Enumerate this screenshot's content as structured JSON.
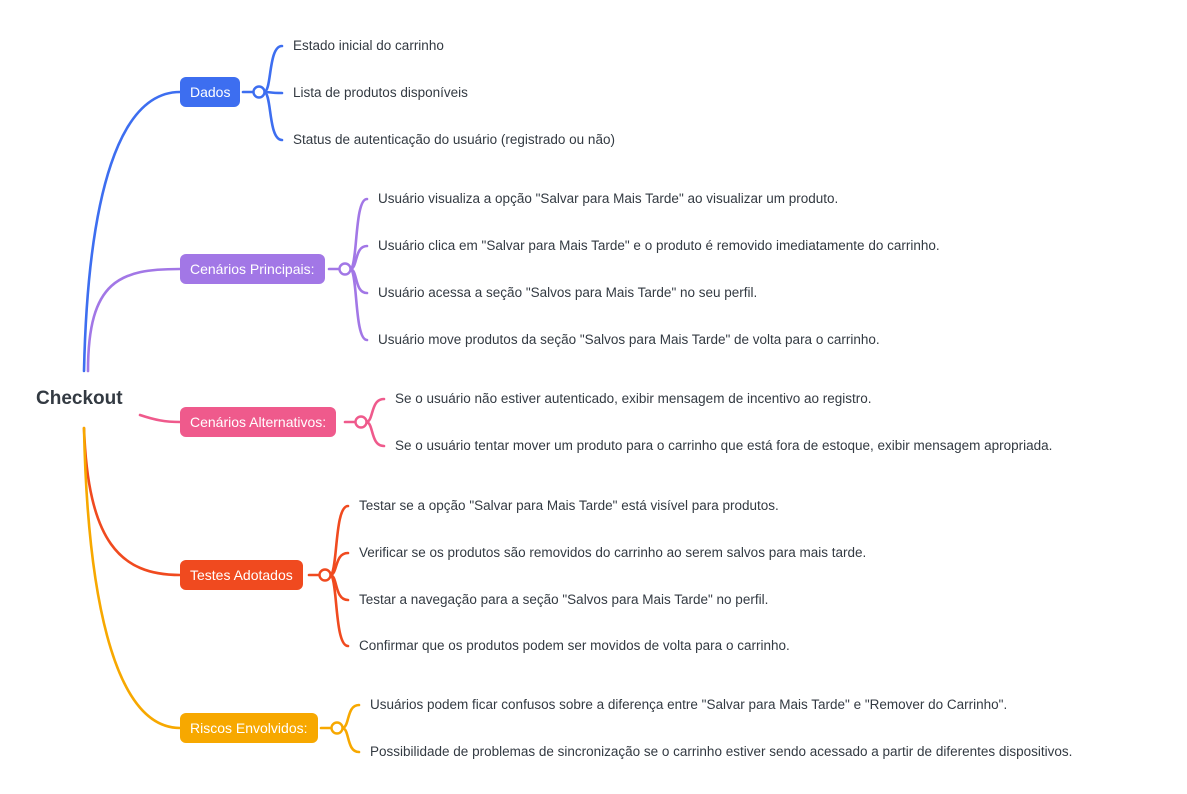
{
  "root": {
    "label": "Checkout"
  },
  "colors": {
    "dados": "#3d6ef0",
    "cenarios_principais": "#a277e6",
    "cenarios_alternativos": "#ef5a8c",
    "testes_adotados": "#f04a1f",
    "riscos_envolvidos": "#f7a800",
    "text": "#333a42"
  },
  "branches": [
    {
      "label": "Dados",
      "items": [
        "Estado inicial do carrinho",
        "Lista de produtos disponíveis",
        "Status de autenticação do usuário (registrado ou não)"
      ]
    },
    {
      "label": "Cenários Principais:",
      "items": [
        "Usuário visualiza a opção \"Salvar para Mais Tarde\" ao visualizar um produto.",
        "Usuário clica em \"Salvar para Mais Tarde\" e o produto é removido imediatamente do carrinho.",
        "Usuário acessa a seção \"Salvos para Mais Tarde\" no seu perfil.",
        "Usuário move produtos da seção \"Salvos para Mais Tarde\" de volta para o carrinho."
      ]
    },
    {
      "label": "Cenários Alternativos:",
      "items": [
        "Se o usuário não estiver autenticado, exibir mensagem de incentivo ao registro.",
        "Se o usuário tentar mover um produto para o carrinho que está fora de estoque, exibir mensagem apropriada."
      ]
    },
    {
      "label": "Testes Adotados",
      "items": [
        "Testar se a opção \"Salvar para Mais Tarde\" está visível para produtos.",
        "Verificar se os produtos são removidos do carrinho ao serem salvos para mais tarde.",
        "Testar a navegação para a seção \"Salvos para Mais Tarde\" no perfil.",
        "Confirmar que os produtos podem ser movidos de volta para o carrinho."
      ]
    },
    {
      "label": "Riscos Envolvidos:",
      "items": [
        "Usuários podem ficar confusos sobre a diferença entre \"Salvar para Mais Tarde\" e \"Remover do Carrinho\".",
        "Possibilidade de problemas de sincronização se o carrinho estiver sendo acessado a partir de diferentes dispositivos."
      ]
    }
  ]
}
